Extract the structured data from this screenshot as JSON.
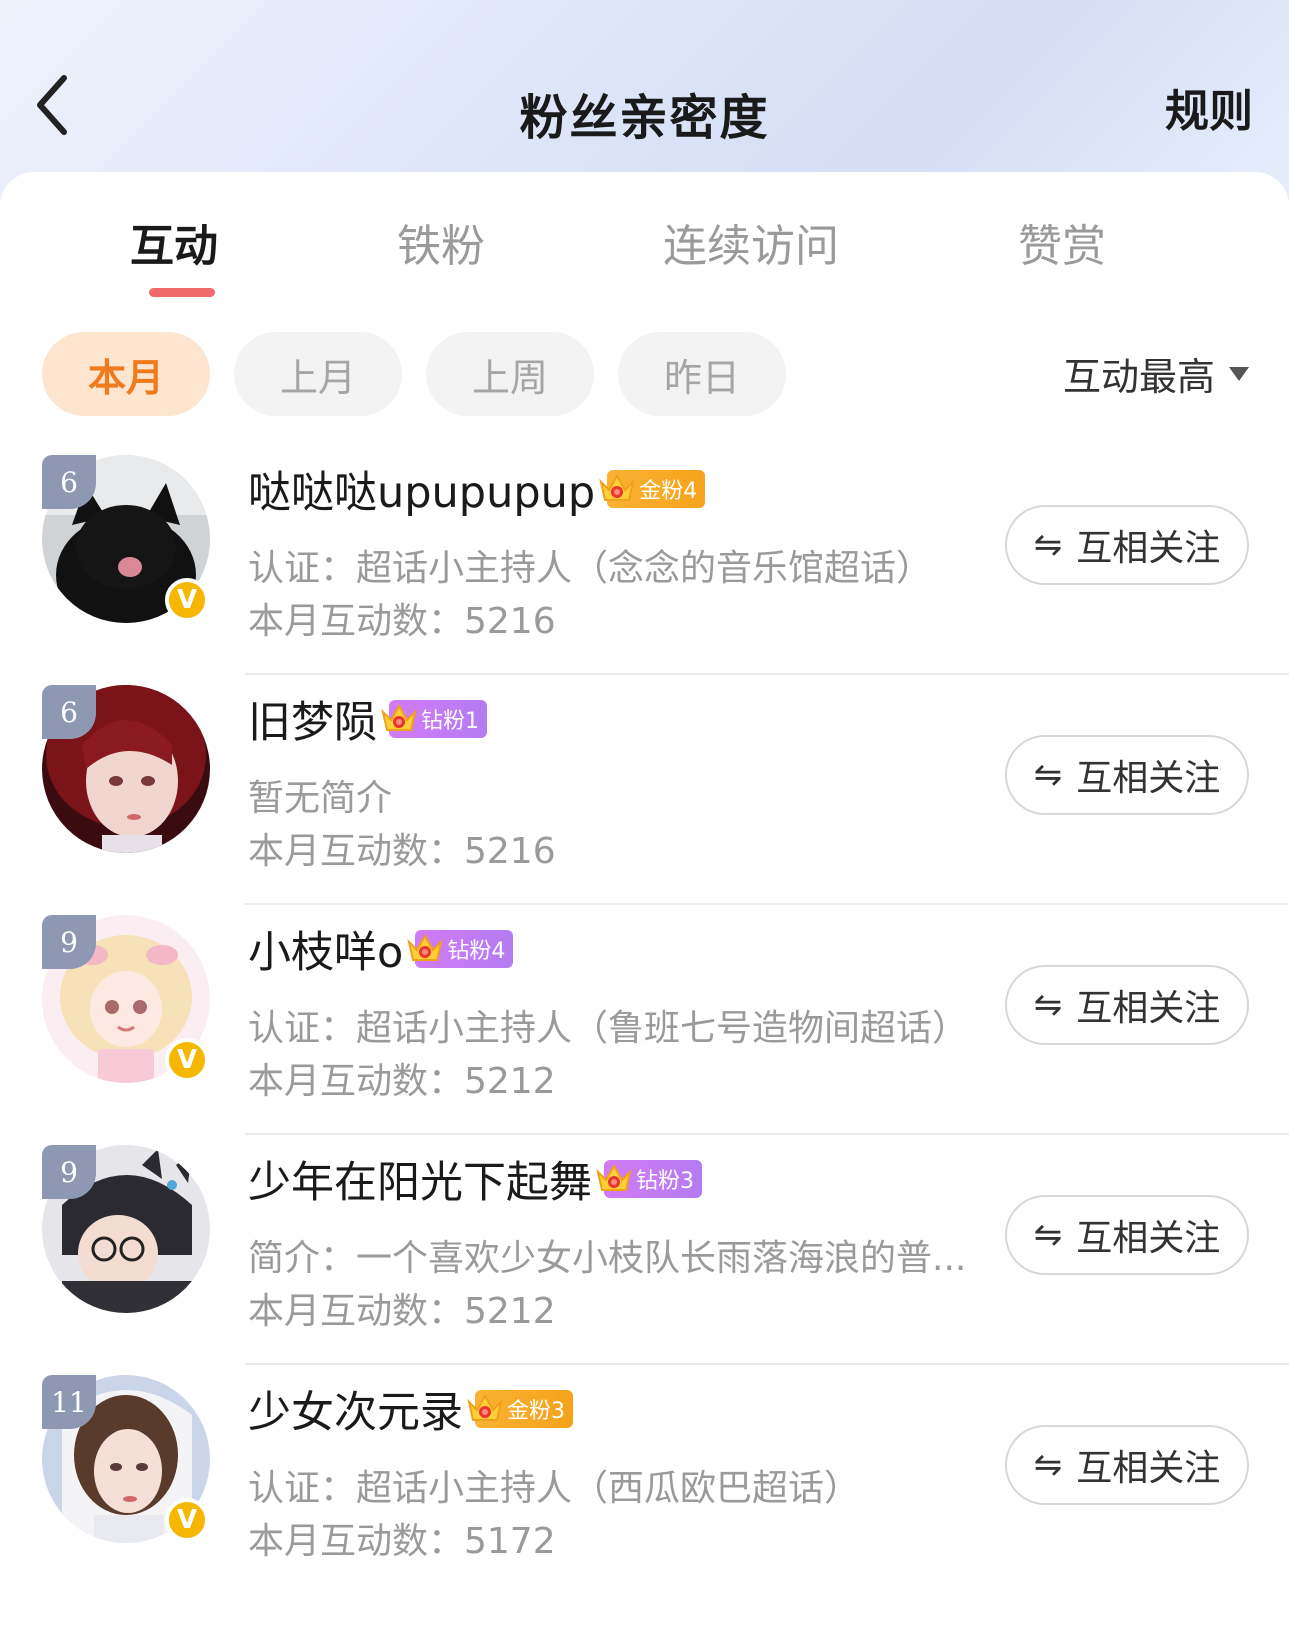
{
  "header": {
    "title": "粉丝亲密度",
    "rules_label": "规则"
  },
  "tabs": [
    {
      "label": "互动",
      "active": true
    },
    {
      "label": "铁粉",
      "active": false
    },
    {
      "label": "连续访问",
      "active": false
    },
    {
      "label": "赞赏",
      "active": false
    }
  ],
  "filters": {
    "chips": [
      {
        "label": "本月",
        "active": true
      },
      {
        "label": "上月",
        "active": false
      },
      {
        "label": "上周",
        "active": false
      },
      {
        "label": "昨日",
        "active": false
      }
    ],
    "sort_label": "互动最高"
  },
  "colors": {
    "accent_orange": "#f07a1e",
    "tab_underline": "#f06a6a",
    "gold_badge": "#f6a21b",
    "diamond_badge": "#c27bf4",
    "verify": "#f5b700"
  },
  "fans": [
    {
      "level": "6",
      "name": "哒哒哒upupupup",
      "badge_type": "gold",
      "badge_level": "6",
      "badge_text": "金粉4",
      "verified": true,
      "bio": "认证：超话小主持人（念念的音乐馆超话）",
      "count": "本月互动数：5216",
      "follow_label": "互相关注",
      "avatar": "black-cat"
    },
    {
      "level": "6",
      "name": "旧梦陨",
      "badge_type": "diamond",
      "badge_level": "5",
      "badge_text": "钻粉1",
      "verified": false,
      "bio": "暂无简介",
      "count": "本月互动数：5216",
      "follow_label": "互相关注",
      "avatar": "red-hair-girl"
    },
    {
      "level": "9",
      "name": "小枝咩o",
      "badge_type": "diamond",
      "badge_level": "7",
      "badge_text": "钻粉4",
      "verified": true,
      "bio": "认证：超话小主持人（鲁班七号造物间超话）",
      "count": "本月互动数：5212",
      "follow_label": "互相关注",
      "avatar": "pink-anime-girl"
    },
    {
      "level": "9",
      "name": "少年在阳光下起舞",
      "badge_type": "diamond",
      "badge_level": "6",
      "badge_text": "钻粉3",
      "verified": false,
      "bio": "简介：一个喜欢少女小枝队长雨落海浪的普...",
      "count": "本月互动数：5212",
      "follow_label": "互相关注",
      "avatar": "anime-boy-cat"
    },
    {
      "level": "11",
      "name": "少女次元录",
      "badge_type": "gold",
      "badge_level": "6",
      "badge_text": "金粉3",
      "verified": true,
      "bio": "认证：超话小主持人（西瓜欧巴超话）",
      "count": "本月互动数：5172",
      "follow_label": "互相关注",
      "avatar": "white-veil-girl"
    }
  ]
}
